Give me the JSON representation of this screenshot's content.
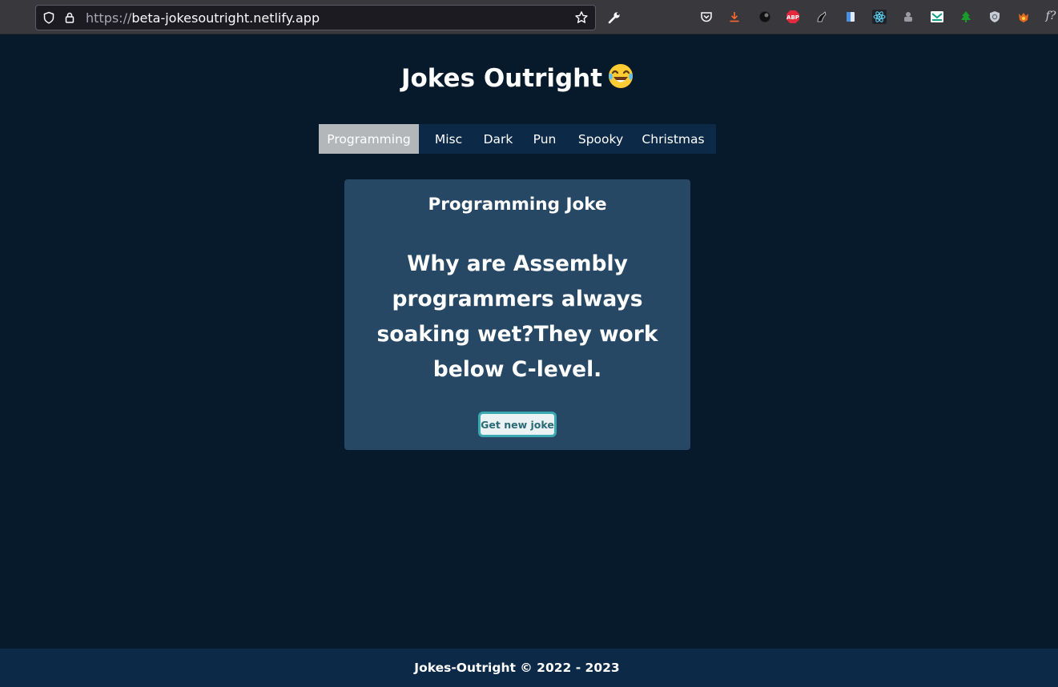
{
  "browser": {
    "url_scheme": "https://",
    "url_host": "beta-jokesoutright.netlify.app",
    "extensions": [
      "pocket-icon",
      "download-icon",
      "ext-dark-icon",
      "adblock-plus-icon",
      "ext-paw-icon",
      "ext-book-icon",
      "react-devtools-icon",
      "ext-puzzle-icon",
      "ext-mail-icon",
      "ext-tree-icon",
      "ext-shield-icon",
      "ext-fox-icon",
      "ext-function-icon"
    ],
    "abp_label": "ABP",
    "fx_label": "f?"
  },
  "site": {
    "title": "Jokes Outright",
    "emoji": "tears-of-joy-emoji"
  },
  "nav": {
    "items": [
      {
        "label": "Programming",
        "active": true
      },
      {
        "label": "Misc",
        "active": false
      },
      {
        "label": "Dark",
        "active": false
      },
      {
        "label": "Pun",
        "active": false
      },
      {
        "label": "Spooky",
        "active": false
      },
      {
        "label": "Christmas",
        "active": false
      }
    ]
  },
  "card": {
    "title": "Programming Joke",
    "joke": "Why are Assembly programmers always soaking wet?They work below C-level.",
    "button_label": "Get new joke"
  },
  "footer": {
    "text": "Jokes-Outright © 2022 - 2023"
  },
  "colors": {
    "page_bg": "#071a2b",
    "nav_bg": "#0c2a47",
    "active_tab": "#b3b7ba",
    "card_bg": "#274865",
    "button_border": "#3ba9b2"
  }
}
